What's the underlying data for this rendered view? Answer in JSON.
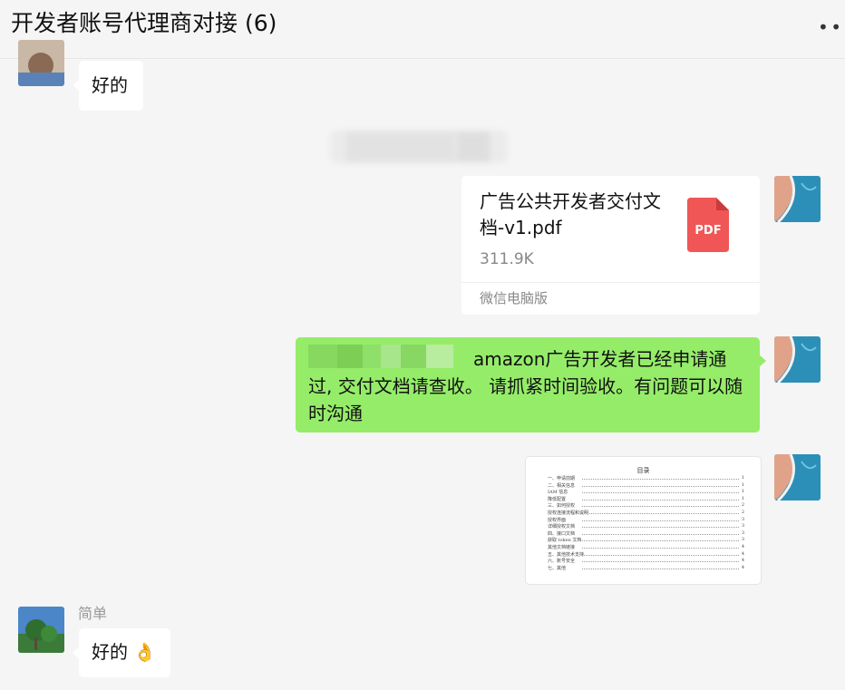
{
  "window": {
    "title": "开发者账号代理商对接 (6)",
    "more_icon": "more-dots-icon"
  },
  "messages": {
    "m1": {
      "text": "好的"
    },
    "file": {
      "name": "广告公共开发者交付文档-v1.pdf",
      "size": "311.9K",
      "source": "微信电脑版",
      "icon": "pdf-file-icon",
      "icon_label": "PDF",
      "icon_color": "#f05656"
    },
    "m3": {
      "text": "amazon广告开发者已经申请通过, 交付文档请查收。 请抓紧时间验收。有问题可以随时沟通"
    },
    "doc_preview": {
      "heading": "目录",
      "entries": [
        {
          "label": "一、申请前期",
          "page": "1"
        },
        {
          "label": "二、相关信息",
          "page": "1"
        },
        {
          "label": "IAM 信息",
          "page": "1"
        },
        {
          "label": "降低配置",
          "page": "1"
        },
        {
          "label": "三、如何授权",
          "page": "2"
        },
        {
          "label": "授权连接流程和说明",
          "page": "2"
        },
        {
          "label": "授权界面",
          "page": "3"
        },
        {
          "label": "详细授权文档",
          "page": "3"
        },
        {
          "label": "四、接口文档",
          "page": "3"
        },
        {
          "label": "获取 token 文档",
          "page": "3"
        },
        {
          "label": "其他文档链接",
          "page": "4"
        },
        {
          "label": "五、其他技术支持",
          "page": "4"
        },
        {
          "label": "六、账号安全",
          "page": "4"
        },
        {
          "label": "七、其他",
          "page": "4"
        }
      ]
    },
    "m5": {
      "sender": "简单",
      "text": "好的 👌"
    }
  },
  "colors": {
    "background": "#f5f5f5",
    "green_bubble": "#95ec69",
    "white_bubble": "#ffffff"
  }
}
